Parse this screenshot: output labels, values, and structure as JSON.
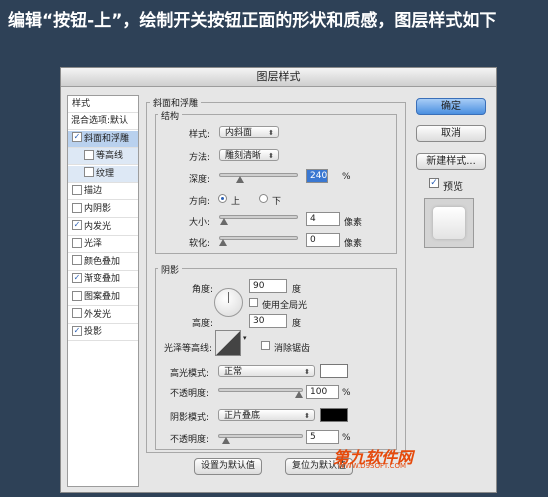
{
  "heading": "编辑“按钮-上”，绘制开关按钮正面的形状和质感，图层样式如下",
  "dialog": {
    "title": "图层样式",
    "sidebar": {
      "header": "样式",
      "items": [
        {
          "label": "混合选项:默认",
          "checkbox": false,
          "checked": false
        },
        {
          "label": "斜面和浮雕",
          "checkbox": true,
          "checked": true
        },
        {
          "label": "等高线",
          "checkbox": true,
          "checked": false
        },
        {
          "label": "纹理",
          "checkbox": true,
          "checked": false
        },
        {
          "label": "描边",
          "checkbox": true,
          "checked": false
        },
        {
          "label": "内阴影",
          "checkbox": true,
          "checked": false
        },
        {
          "label": "内发光",
          "checkbox": true,
          "checked": true
        },
        {
          "label": "光泽",
          "checkbox": true,
          "checked": false
        },
        {
          "label": "颜色叠加",
          "checkbox": true,
          "checked": false
        },
        {
          "label": "渐变叠加",
          "checkbox": true,
          "checked": true
        },
        {
          "label": "图案叠加",
          "checkbox": true,
          "checked": false
        },
        {
          "label": "外发光",
          "checkbox": true,
          "checked": false
        },
        {
          "label": "投影",
          "checkbox": true,
          "checked": true
        }
      ]
    },
    "bevel": {
      "title": "斜面和浮雕",
      "structure": {
        "title": "结构",
        "style_label": "样式:",
        "style_value": "内斜面",
        "technique_label": "方法:",
        "technique_value": "雕刻清晰",
        "depth_label": "深度:",
        "depth_value": "240",
        "depth_unit": "%",
        "depth_level": 0.24,
        "direction_label": "方向:",
        "direction_up": "上",
        "direction_down": "下",
        "size_label": "大小:",
        "size_value": "4",
        "size_unit": "像素",
        "size_level": 0.02,
        "soften_label": "软化:",
        "soften_value": "0",
        "soften_unit": "像素",
        "soften_level": 0.0
      },
      "shading": {
        "title": "阴影",
        "angle_label": "角度:",
        "angle_value": "90",
        "angle_unit": "度",
        "global_light_label": "使用全局光",
        "altitude_label": "高度:",
        "altitude_value": "30",
        "altitude_unit": "度",
        "gloss_label": "光泽等高线:",
        "antialias_label": "消除锯齿",
        "highlight_mode_label": "高光模式:",
        "highlight_mode_value": "正常",
        "highlight_opacity_label": "不透明度:",
        "highlight_opacity_value": "100",
        "highlight_opacity_unit": "%",
        "highlight_opacity_level": 1.0,
        "highlight_color": "#ffffff",
        "shadow_mode_label": "阴影模式:",
        "shadow_mode_value": "正片叠底",
        "shadow_opacity_label": "不透明度:",
        "shadow_opacity_value": "5",
        "shadow_opacity_unit": "%",
        "shadow_opacity_level": 0.05,
        "shadow_color": "#000000"
      },
      "make_default": "设置为默认值",
      "reset_default": "复位为默认值"
    },
    "buttons": {
      "ok": "确定",
      "cancel": "取消",
      "new_style": "新建样式...",
      "preview": "预览"
    }
  },
  "watermark": {
    "text": "第九软件网",
    "sub": "WWW.D9SOFT.COM"
  }
}
